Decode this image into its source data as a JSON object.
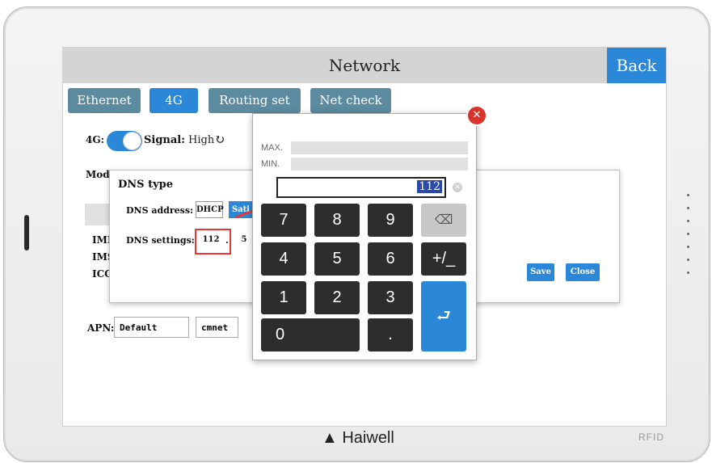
{
  "screen": {
    "title": "Network",
    "back_label": "Back"
  },
  "tabs": [
    {
      "label": "Ethernet"
    },
    {
      "label": "4G"
    },
    {
      "label": "Routing set"
    },
    {
      "label": "Net check"
    }
  ],
  "fourg": {
    "label": "4G:",
    "signal_label": "Signal:",
    "signal_value": "High",
    "mode_label": "Mode",
    "info_labels": [
      "IME",
      "IMS",
      "ICC"
    ],
    "apn_label": "APN:",
    "apn_value": "Default",
    "apn_option": "cmnet"
  },
  "dns_dialog": {
    "title": "DNS type",
    "address_label": "DNS address:",
    "address_options": [
      "DHCP",
      "Sati"
    ],
    "settings_label": "DNS settings:",
    "octet_1": "112",
    "dot": ".",
    "octet_2": "5",
    "save_label": "Save",
    "close_label": "Close"
  },
  "keypad": {
    "max_label": "MAX.",
    "min_label": "MIN.",
    "display_value": "112",
    "keys": [
      "7",
      "8",
      "9",
      "4",
      "5",
      "6",
      "+/_",
      "1",
      "2",
      "3",
      "0",
      "."
    ]
  },
  "brand": {
    "name": "Haiwell",
    "rfid": "RFID"
  },
  "colors": {
    "accent": "#2b88d8",
    "tab": "#5c8a9e",
    "danger": "#d9342b"
  }
}
